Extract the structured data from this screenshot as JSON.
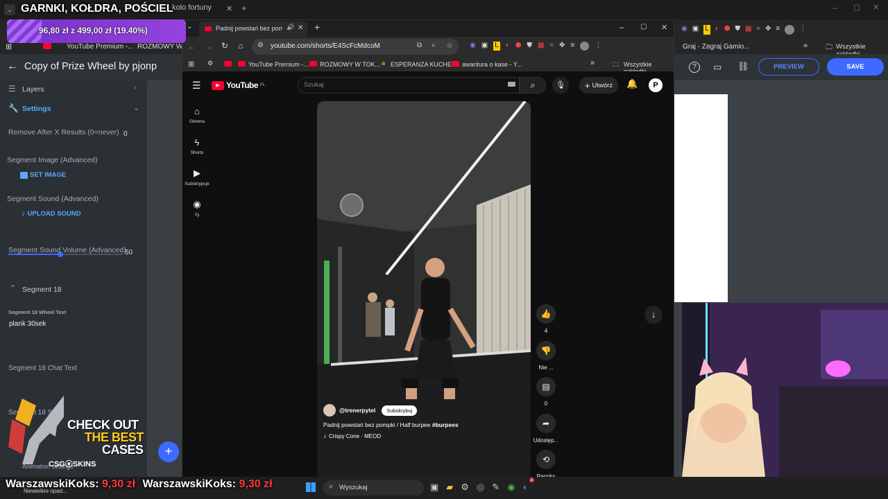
{
  "stream_overlay": {
    "title": "GARNKI, KOŁDRA, POŚCIEL",
    "price_text": "96,80 zł z 499,00 zł (19.40%)",
    "donation_1_name": "WarszawskiKoks:",
    "donation_1_amount": "9,30 zł",
    "donation_2_name": "WarszawskiKoks:",
    "donation_2_amount": "9,30 zł",
    "ad_line1": "CHECK OUT",
    "ad_line2": "THE BEST",
    "ad_line3": "CASES",
    "ad_brand": "CSG⦿SKINS",
    "weather": "Niewielkie opad..."
  },
  "back_browser": {
    "tab_label": "kolo fortuny",
    "bookmarks": [
      "YouTube Premium -...",
      "ROZMOWY W TO...",
      "Graj - Zagraj Gamio..."
    ],
    "all_bookmarks": "Wszystkie zakładki"
  },
  "editor": {
    "title": "Copy of Prize Wheel by pjonp",
    "preview_label": "PREVIEW",
    "save_label": "SAVE",
    "layers_label": "Layers",
    "settings_label": "Settings",
    "remove_after_label": "Remove After X Results (0=never)",
    "remove_after_value": "0",
    "segment_image_label": "Segment Image (Advanced)",
    "set_image_label": "SET IMAGE",
    "segment_sound_label": "Segment Sound (Advanced)",
    "upload_sound_label": "UPLOAD SOUND",
    "segment_volume_label": "Segment Sound Volume (Advanced)",
    "segment_volume_value": "50",
    "segment_heading": "Segment 18",
    "wheel_text_label": "Segment 18 Wheel Text",
    "wheel_text_value": "plank 30sek",
    "chat_text_label": "Segment 18 Chat Text",
    "size_label_partial": "Segment 18 Si",
    "animation_label": "Animation settings"
  },
  "front_browser": {
    "tab_title": "Padnij powstań bez pompk",
    "new_tab": "+",
    "url": "youtube.com/shorts/E4ScFcMdcoM",
    "bookmarks": [
      "YouTube Premium -...",
      "ROZMOWY W TOK...",
      "ESPERANZA KUCHE...",
      "awantura o kase - Y..."
    ],
    "all_bookmarks": "Wszystkie zakładki"
  },
  "youtube": {
    "logo": "YouTube",
    "region": "PL",
    "search_placeholder": "Szukaj",
    "create_label": "Utwórz",
    "avatar_letter": "P",
    "nav": [
      {
        "label": "Główna",
        "icon": "home-icon"
      },
      {
        "label": "Shorts",
        "icon": "shorts-icon"
      },
      {
        "label": "Subskrypcje",
        "icon": "subscriptions-icon"
      },
      {
        "label": "Ty",
        "icon": "user-icon"
      }
    ],
    "likes": "4",
    "dislike_label": "Nie ...",
    "comments": "0",
    "share_label": "Udostęp...",
    "remix_label": "Remiks",
    "channel": "@trenerpytel",
    "subscribe_label": "Subskrybuj",
    "video_title": "Padnij powstań bez pompki / Half burpee ",
    "video_hashtag": "#burpees",
    "music": "Crispy Cone · MEOD"
  },
  "taskbar": {
    "search_label": "Wyszukaj",
    "discord_badge": "3"
  },
  "colors": {
    "accent_blue": "#3d6bff",
    "link_blue": "#5aa8ff",
    "youtube_red": "#ff0033",
    "promo_purple": "#8a3be0",
    "promo_green": "#8cff4a",
    "donation_red": "#ff3b3b"
  }
}
